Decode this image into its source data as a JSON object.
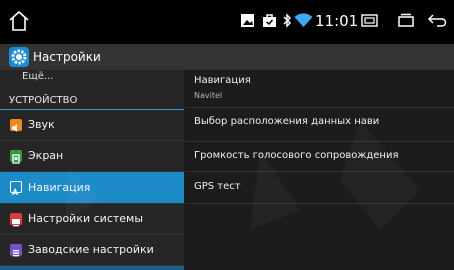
{
  "status_bar": {
    "time": "11:01",
    "icons": [
      "home-icon",
      "image-icon",
      "bag-icon",
      "bluetooth-icon",
      "wifi-icon",
      "card-icon",
      "recent-apps-icon",
      "back-icon"
    ]
  },
  "app_bar": {
    "title": "Настройки",
    "icon": "settings-gear-icon",
    "icon_color": "#1c8bd6"
  },
  "sidebar": {
    "more_label": "Ещё...",
    "section_header": "УСТРОЙСТВО",
    "items": [
      {
        "label": "Звук",
        "icon": "sound-icon",
        "icon_color": "#f08a1c",
        "active": false
      },
      {
        "label": "Экран",
        "icon": "display-icon",
        "icon_color": "#2e9e3e",
        "active": false
      },
      {
        "label": "Навигация",
        "icon": "navigation-icon",
        "icon_color": "#1e8bc9",
        "active": true
      },
      {
        "label": "Настройки системы",
        "icon": "system-settings-icon",
        "icon_color": "#e0383a",
        "active": false
      },
      {
        "label": "Заводские настройки",
        "icon": "factory-settings-icon",
        "icon_color": "#7b4fc6",
        "active": false
      }
    ],
    "accent_color": "#1e8bc9"
  },
  "main": {
    "items": [
      {
        "title": "Навигация",
        "summary": "Navitel"
      },
      {
        "title": "Выбор расположения данных нави"
      },
      {
        "title": "Громкость голосового сопровождения"
      },
      {
        "title": "GPS тест"
      }
    ]
  }
}
